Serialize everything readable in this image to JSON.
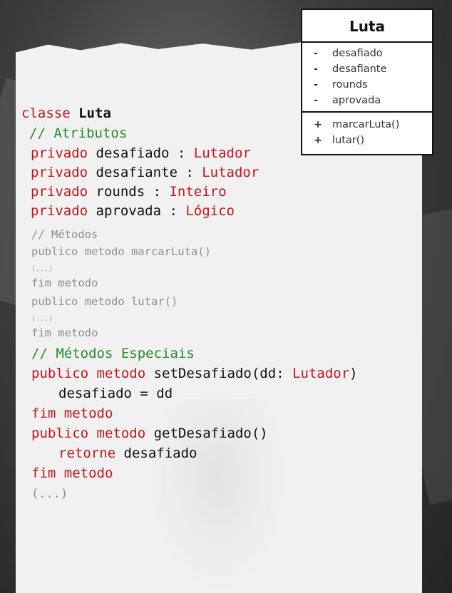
{
  "uml": {
    "title": "Luta",
    "attributes": [
      {
        "vis": "-",
        "name": "desafiado"
      },
      {
        "vis": "-",
        "name": "desafiante"
      },
      {
        "vis": "-",
        "name": "rounds"
      },
      {
        "vis": "-",
        "name": "aprovada"
      }
    ],
    "operations": [
      {
        "vis": "+",
        "name": "marcarLuta()"
      },
      {
        "vis": "+",
        "name": "lutar()"
      }
    ]
  },
  "code": {
    "class_kw": "classe ",
    "class_name": "Luta",
    "c_attrs": "// Atributos",
    "a1_kw": "privado",
    "a1_name": " desafiado : ",
    "a1_type": "Lutador",
    "a2_kw": "privado",
    "a2_name": " desafiante : ",
    "a2_type": "Lutador",
    "a3_kw": "privado",
    "a3_name": " rounds : ",
    "a3_type": "Inteiro",
    "a4_kw": "privado",
    "a4_name": " aprovada : ",
    "a4_type": "Lógico",
    "c_methods": "// Métodos",
    "m1": "publico metodo marcarLuta()",
    "m1_body": "(...)",
    "m1_end": "fim metodo",
    "m2": "publico metodo lutar()",
    "m2_body": "(...)",
    "m2_end": "fim metodo",
    "c_special": "// Métodos Especiais",
    "s1_kw": "publico metodo",
    "s1_sig": " setDesafiado(dd: ",
    "s1_type": "Lutador",
    "s1_close": ")",
    "s1_body": "desafiado = dd",
    "s1_end": "fim metodo",
    "s2_kw": "publico metodo",
    "s2_sig": " getDesafiado()",
    "s2_ret_kw": "retorne",
    "s2_ret_val": " desafiado",
    "s2_end": "fim metodo",
    "ellipsis": "(...)"
  }
}
